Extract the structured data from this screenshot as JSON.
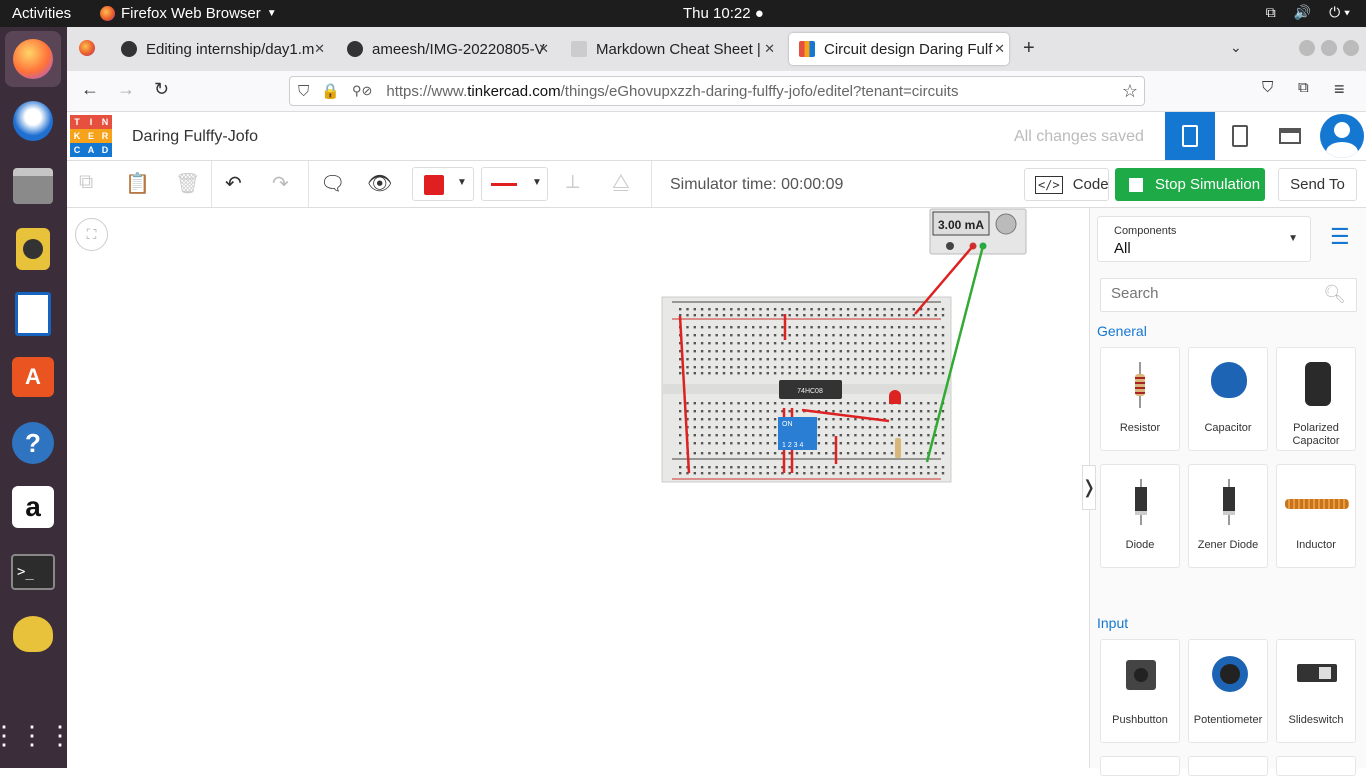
{
  "topbar": {
    "activities": "Activities",
    "app_name": "Firefox Web Browser",
    "clock": "Thu 10:22"
  },
  "tabs": [
    {
      "title": "Editing internship/day1.m",
      "active": false
    },
    {
      "title": "ameesh/IMG-20220805-V",
      "active": false
    },
    {
      "title": "Markdown Cheat Sheet |",
      "active": false
    },
    {
      "title": "Circuit design Daring Fulf",
      "active": true
    }
  ],
  "url": {
    "prefix": "https://www.",
    "domain": "tinkercad.com",
    "path": "/things/eGhovupxzzh-daring-fulffy-jofo/editel?tenant=circuits"
  },
  "tinkercad": {
    "logo_letters": [
      "T",
      "I",
      "N",
      "K",
      "E",
      "R",
      "C",
      "A",
      "D"
    ],
    "project_title": "Daring Fulffy-Jofo",
    "save_status": "All changes saved"
  },
  "toolbar": {
    "simulator_time": "Simulator time: 00:00:09",
    "code_label": "Code",
    "stop_sim_label": "Stop Simulation",
    "send_to_label": "Send To",
    "color_swatch": "#e02020"
  },
  "multimeter": {
    "reading": "3.00 mA"
  },
  "breadboard": {
    "chip_label": "74HC08",
    "dip_label": "ON",
    "dip_numbers": "1 2 3 4"
  },
  "panel": {
    "components_label": "Components",
    "components_value": "All",
    "search_placeholder": "Search",
    "sections": [
      {
        "title": "General",
        "items": [
          "Resistor",
          "Capacitor",
          "Polarized Capacitor",
          "Diode",
          "Zener Diode",
          "Inductor"
        ]
      },
      {
        "title": "Input",
        "items": [
          "Pushbutton",
          "Potentiometer",
          "Slideswitch"
        ]
      }
    ]
  }
}
